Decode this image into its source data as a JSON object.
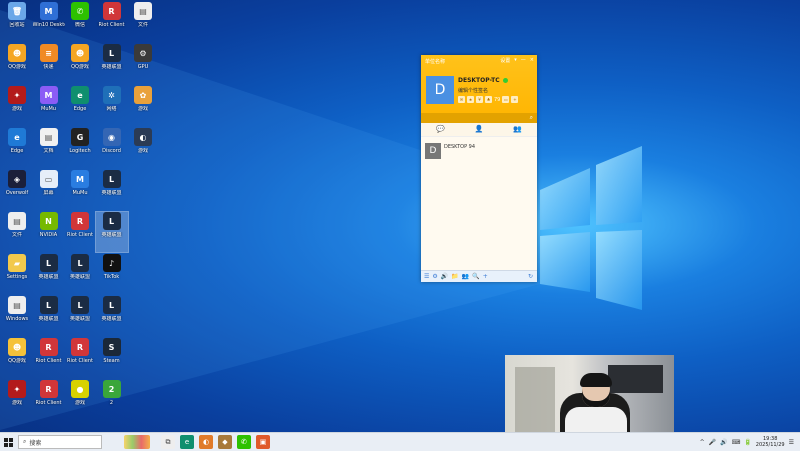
{
  "desktop_icons": [
    {
      "label": "回收站",
      "color": "#6aa7e8",
      "glyph": "🗑",
      "col": 0,
      "row": 0
    },
    {
      "label": "Win10 Desktop",
      "color": "#2f6fd6",
      "glyph": "M",
      "col": 1,
      "row": 0
    },
    {
      "label": "微信",
      "color": "#2dc100",
      "glyph": "✆",
      "col": 2,
      "row": 0
    },
    {
      "label": "Riot Client",
      "color": "#d13639",
      "glyph": "R",
      "col": 3,
      "row": 0
    },
    {
      "label": "文件",
      "color": "#eeeeee",
      "glyph": "▤",
      "col": 4,
      "row": 0
    },
    {
      "label": "QQ游戏",
      "color": "#f5a623",
      "glyph": "☻",
      "col": 0,
      "row": 1
    },
    {
      "label": "快递",
      "color": "#f08a24",
      "glyph": "≡",
      "col": 1,
      "row": 1
    },
    {
      "label": "QQ游戏",
      "color": "#f5a623",
      "glyph": "☻",
      "col": 2,
      "row": 1
    },
    {
      "label": "英雄联盟",
      "color": "#1b2c44",
      "glyph": "L",
      "col": 3,
      "row": 1
    },
    {
      "label": "GPU",
      "color": "#3a3a3a",
      "glyph": "⚙",
      "col": 4,
      "row": 1
    },
    {
      "label": "游戏",
      "color": "#b31b1b",
      "glyph": "✦",
      "col": 0,
      "row": 2
    },
    {
      "label": "MuMu",
      "color": "#8b5cf6",
      "glyph": "M",
      "col": 1,
      "row": 2
    },
    {
      "label": "Edge",
      "color": "#0f8f6e",
      "glyph": "e",
      "col": 2,
      "row": 2
    },
    {
      "label": "网络",
      "color": "#1f6fb8",
      "glyph": "✲",
      "col": 3,
      "row": 2
    },
    {
      "label": "游戏",
      "color": "#e9a13b",
      "glyph": "✿",
      "col": 4,
      "row": 2
    },
    {
      "label": "Edge",
      "color": "#1f7ad6",
      "glyph": "e",
      "col": 0,
      "row": 3
    },
    {
      "label": "文档",
      "color": "#f1f1f1",
      "glyph": "▤",
      "col": 1,
      "row": 3
    },
    {
      "label": "Logitech",
      "color": "#222222",
      "glyph": "G",
      "col": 2,
      "row": 3
    },
    {
      "label": "Discord",
      "color": "#3466b4",
      "glyph": "◉",
      "col": 3,
      "row": 3
    },
    {
      "label": "游戏",
      "color": "#2b3b55",
      "glyph": "◐",
      "col": 4,
      "row": 3
    },
    {
      "label": "Overwolf",
      "color": "#1b1f3a",
      "glyph": "◈",
      "col": 0,
      "row": 4
    },
    {
      "label": "屏幕",
      "color": "#e6eef9",
      "glyph": "▭",
      "col": 1,
      "row": 4
    },
    {
      "label": "MuMu",
      "color": "#2a7de1",
      "glyph": "M",
      "col": 2,
      "row": 4
    },
    {
      "label": "英雄联盟",
      "color": "#1b2c44",
      "glyph": "L",
      "col": 3,
      "row": 4
    },
    {
      "label": "文件",
      "color": "#eeeeee",
      "glyph": "▤",
      "col": 0,
      "row": 5
    },
    {
      "label": "NVIDIA",
      "color": "#76b900",
      "glyph": "N",
      "col": 1,
      "row": 5
    },
    {
      "label": "Riot Client",
      "color": "#d13639",
      "glyph": "R",
      "col": 2,
      "row": 5
    },
    {
      "label": "英雄联盟",
      "color": "#1b2c44",
      "glyph": "L",
      "col": 3,
      "row": 5,
      "selected": true
    },
    {
      "label": "Settings",
      "color": "#f2c94c",
      "glyph": "▰",
      "col": 0,
      "row": 6
    },
    {
      "label": "英雄联盟",
      "color": "#1b2c44",
      "glyph": "L",
      "col": 1,
      "row": 6
    },
    {
      "label": "英雄联盟",
      "color": "#1b2c44",
      "glyph": "L",
      "col": 2,
      "row": 6
    },
    {
      "label": "TikTok",
      "color": "#111111",
      "glyph": "♪",
      "col": 3,
      "row": 6
    },
    {
      "label": "Windows",
      "color": "#eeeeee",
      "glyph": "▤",
      "col": 0,
      "row": 7
    },
    {
      "label": "英雄联盟",
      "color": "#1b2c44",
      "glyph": "L",
      "col": 1,
      "row": 7
    },
    {
      "label": "英雄联盟",
      "color": "#1b2c44",
      "glyph": "L",
      "col": 2,
      "row": 7
    },
    {
      "label": "英雄联盟",
      "color": "#1b2c44",
      "glyph": "L",
      "col": 3,
      "row": 7
    },
    {
      "label": "QQ游戏",
      "color": "#f5c23a",
      "glyph": "☻",
      "col": 0,
      "row": 8
    },
    {
      "label": "Riot Client",
      "color": "#d13639",
      "glyph": "R",
      "col": 1,
      "row": 8
    },
    {
      "label": "Riot Client",
      "color": "#d13639",
      "glyph": "R",
      "col": 2,
      "row": 8
    },
    {
      "label": "Steam",
      "color": "#1b2838",
      "glyph": "S",
      "col": 3,
      "row": 8
    },
    {
      "label": "游戏",
      "color": "#b31b1b",
      "glyph": "✦",
      "col": 0,
      "row": 9
    },
    {
      "label": "Riot Client",
      "color": "#d13639",
      "glyph": "R",
      "col": 1,
      "row": 9
    },
    {
      "label": "游戏",
      "color": "#d8d200",
      "glyph": "●",
      "col": 2,
      "row": 9
    },
    {
      "label": "2",
      "color": "#3aa63a",
      "glyph": "2",
      "col": 3,
      "row": 9
    }
  ],
  "chat_window": {
    "title": "单位名称",
    "controls": [
      "设置",
      "▾",
      "—",
      "×"
    ],
    "user_name": "DESKTOP-TC",
    "avatar_letter": "D",
    "signature": "编辑个性签名",
    "badge_number": "79",
    "tabs": [
      {
        "icon": "💬",
        "active": true
      },
      {
        "icon": "👤",
        "active": false
      },
      {
        "icon": "👥",
        "active": false
      }
    ],
    "contacts": [
      {
        "avatar": "D",
        "name": "DESKTOP 94"
      }
    ],
    "bottom_icons": [
      "☰",
      "⚙",
      "🔊",
      "📁",
      "👥",
      "🔍",
      "+"
    ],
    "refresh_icon": "↻"
  },
  "taskbar": {
    "search_placeholder": "搜索",
    "apps": [
      {
        "name": "task-view",
        "glyph": "⧉",
        "color": "#eeeeee"
      },
      {
        "name": "edge",
        "glyph": "e",
        "color": "#0f8f6e"
      },
      {
        "name": "app-orange",
        "glyph": "◐",
        "color": "#e07b2a"
      },
      {
        "name": "app-brown",
        "glyph": "◆",
        "color": "#a87a3a"
      },
      {
        "name": "wechat",
        "glyph": "✆",
        "color": "#2dc100"
      },
      {
        "name": "app-red",
        "glyph": "▣",
        "color": "#e05a2a"
      }
    ],
    "tray_icons": [
      "^",
      "🎤",
      "🔊",
      "⌨",
      "🔋",
      "☰"
    ],
    "time": "19:38",
    "date": "2025/11/29"
  }
}
